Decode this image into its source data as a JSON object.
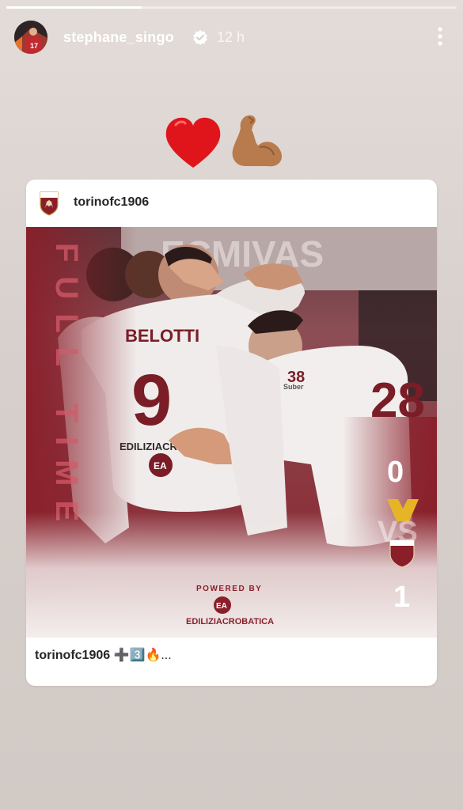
{
  "story": {
    "progress": 0.3,
    "username": "stephane_singo",
    "verified": true,
    "timestamp": "12 h",
    "stickers": [
      "red-heart-emoji",
      "flexed-biceps-emoji"
    ]
  },
  "post": {
    "account": "torinofc1906",
    "caption_account": "torinofc1906",
    "caption_text": "➕3️⃣🔥...",
    "image": {
      "banner_text": "FULL TIME",
      "jersey_name": "BELOTTI",
      "jersey_number": "9",
      "jersey_number_2": "28",
      "jersey_number_3": "38",
      "sponsor": "EDILIZIACROBATICA",
      "sponsor_short": "EA",
      "sleeve_text": "Suber",
      "home_score": "0",
      "vs_label": "VS",
      "away_score": "1",
      "powered_by": "POWERED BY",
      "powered_sponsor": "EDILIZIACROBATICA"
    }
  },
  "colors": {
    "accent": "#8a1f2a",
    "background": "#d9d1cd"
  }
}
